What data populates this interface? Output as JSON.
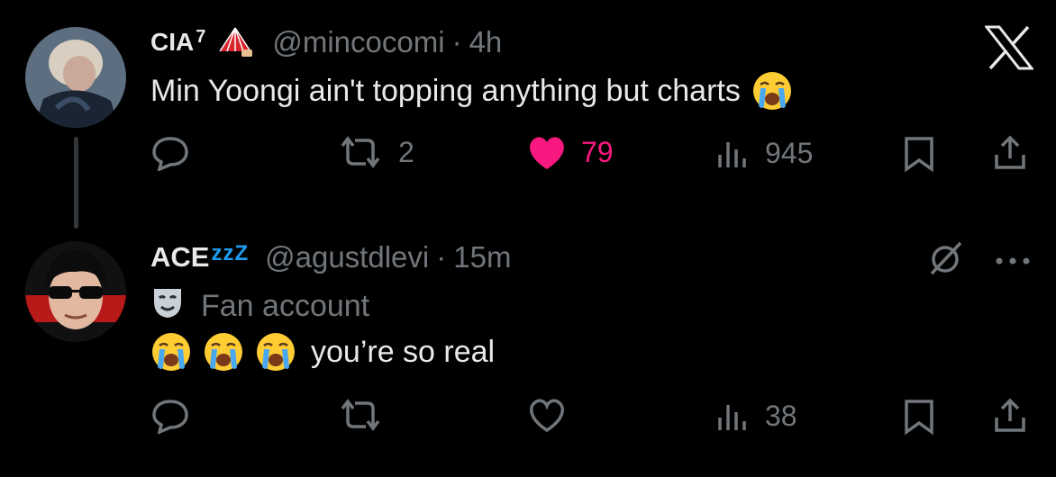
{
  "tweet1": {
    "display_name": "CIA",
    "name_superscript": "7",
    "handle": "@mincocomi",
    "separator": "·",
    "time": "4h",
    "text": "Min Yoongi ain't topping anything but charts",
    "emoji": "loudly-crying-face",
    "actions": {
      "retweets": "2",
      "likes": "79",
      "views": "945"
    },
    "liked": true
  },
  "tweet2": {
    "display_name": "ACE",
    "name_suffix": "zzZ",
    "handle": "@agustdlevi",
    "separator": "·",
    "time": "15m",
    "label": "Fan account",
    "text": "you’re so real",
    "emoji_count": 3,
    "actions": {
      "views": "38"
    },
    "liked": false
  },
  "colors": {
    "background": "#000000",
    "primary_text": "#e7e9ea",
    "secondary_text": "#71767b",
    "like_pink": "#f91880",
    "zzz_blue": "#1d9bf0"
  },
  "icons": [
    "x-logo",
    "fan-emoji",
    "comment-icon",
    "retweet-icon",
    "heart-icon",
    "views-icon",
    "bookmark-icon",
    "share-icon",
    "grok-icon",
    "more-icon",
    "drama-mask-icon"
  ]
}
